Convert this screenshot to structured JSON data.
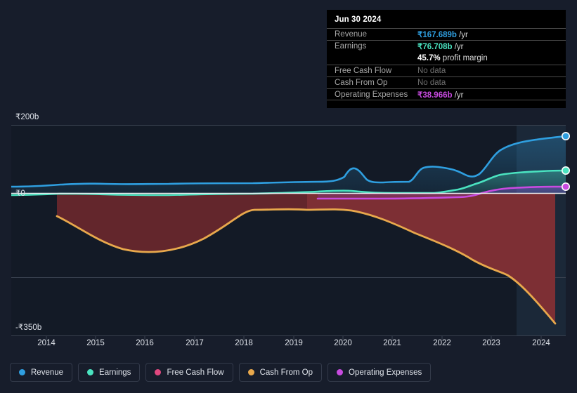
{
  "axes": {
    "y_labels": {
      "top": "₹200b",
      "zero": "₹0",
      "bottom": "-₹350b"
    },
    "x_labels": [
      "2014",
      "2015",
      "2016",
      "2017",
      "2018",
      "2019",
      "2020",
      "2021",
      "2022",
      "2023",
      "2024"
    ]
  },
  "tooltip": {
    "date": "Jun 30 2024",
    "rows": [
      {
        "label": "Revenue",
        "value": "₹167.689b",
        "unit": "/yr",
        "color": "#2f9fe0",
        "nodata": false
      },
      {
        "label": "Earnings",
        "value": "₹76.708b",
        "unit": "/yr",
        "color": "#4ae3c0",
        "nodata": false
      },
      {
        "label": "Free Cash Flow",
        "value": "No data",
        "unit": "",
        "color": "#6f6f6f",
        "nodata": true
      },
      {
        "label": "Cash From Op",
        "value": "No data",
        "unit": "",
        "color": "#6f6f6f",
        "nodata": true
      },
      {
        "label": "Operating Expenses",
        "value": "₹38.966b",
        "unit": "/yr",
        "color": "#c84be0",
        "nodata": false
      }
    ],
    "profit_margin_value": "45.7%",
    "profit_margin_label": "profit margin"
  },
  "legend": [
    {
      "label": "Revenue",
      "color": "#2f9fe0"
    },
    {
      "label": "Earnings",
      "color": "#4ae3c0"
    },
    {
      "label": "Free Cash Flow",
      "color": "#e0487f"
    },
    {
      "label": "Cash From Op",
      "color": "#e8a84c"
    },
    {
      "label": "Operating Expenses",
      "color": "#c84be0"
    }
  ],
  "chart_data": {
    "type": "line",
    "title": "",
    "xlabel": "",
    "ylabel": "",
    "currency": "INR",
    "ylim": [
      -350,
      200
    ],
    "units": "billions",
    "grid": true,
    "legend_position": "bottom-left",
    "forecast_start": "2023.6",
    "x": [
      2013.8,
      2014,
      2015,
      2016,
      2017,
      2018,
      2019,
      2019.5,
      2019.8,
      2020,
      2020.5,
      2021,
      2021.5,
      2022,
      2022.5,
      2023,
      2023.5,
      2024,
      2024.5
    ],
    "series": [
      {
        "name": "Revenue",
        "color": "#2f9fe0",
        "values": [
          16,
          17,
          20,
          20,
          22,
          23,
          25,
          44,
          26,
          26,
          27,
          47,
          48,
          30,
          33,
          72,
          112,
          140,
          167.689
        ],
        "end_label": "₹167.689b"
      },
      {
        "name": "Earnings",
        "color": "#4ae3c0",
        "values": [
          3,
          3,
          4,
          4,
          4,
          4,
          4,
          5,
          5,
          5,
          4,
          5,
          6,
          9,
          13,
          30,
          45,
          58,
          76.708
        ],
        "end_label": "₹76.708b"
      },
      {
        "name": "Free Cash Flow",
        "color": "#e0487f",
        "values": [
          null,
          null,
          null,
          null,
          null,
          null,
          null,
          null,
          null,
          null,
          null,
          null,
          null,
          null,
          null,
          null,
          null,
          null,
          null
        ],
        "end_label": "No data"
      },
      {
        "name": "Cash From Op",
        "color": "#e8a84c",
        "values": [
          null,
          -60,
          -140,
          -155,
          -105,
          -72,
          -152,
          -180,
          -75,
          -55,
          -60,
          -90,
          -110,
          -133,
          -140,
          -182,
          -225,
          -245,
          -330
        ],
        "end_label": "No data"
      },
      {
        "name": "Operating Expenses",
        "color": "#c84be0",
        "values": [
          null,
          null,
          null,
          null,
          null,
          null,
          7,
          7,
          7,
          8,
          8,
          8,
          8,
          9,
          10,
          22,
          30,
          34,
          38.966
        ],
        "end_label": "₹38.966b"
      }
    ]
  }
}
